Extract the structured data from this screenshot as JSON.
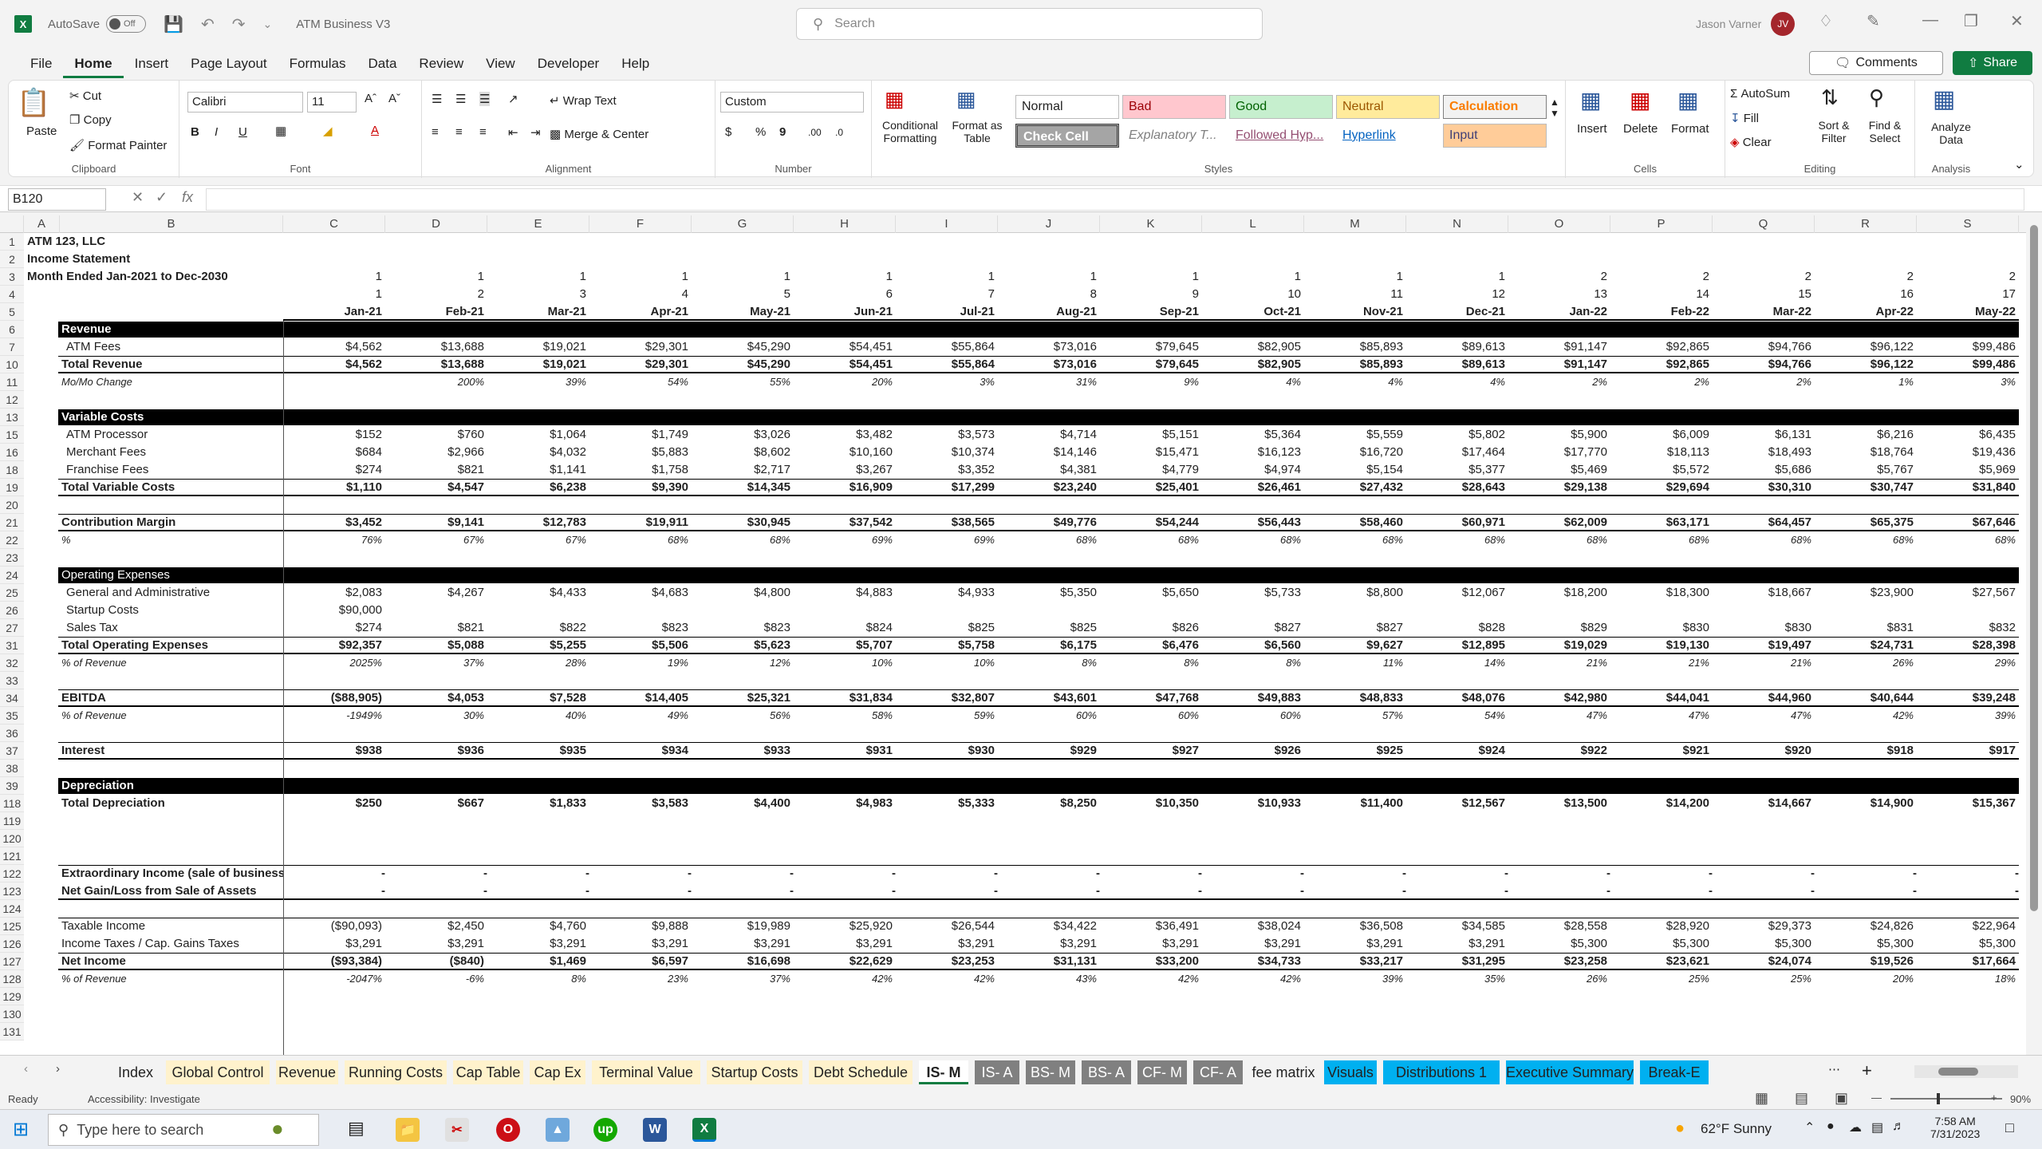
{
  "titlebar": {
    "autosave": "AutoSave",
    "autosave_state": "Off",
    "doc": "ATM Business V3",
    "search_placeholder": "Search",
    "user": "Jason Varner",
    "initials": "JV"
  },
  "menu": [
    "File",
    "Home",
    "Insert",
    "Page Layout",
    "Formulas",
    "Data",
    "Review",
    "View",
    "Developer",
    "Help"
  ],
  "buttons": {
    "comments": "Comments",
    "share": "Share"
  },
  "ribbon": {
    "paste": "Paste",
    "cut": "Cut",
    "copy": "Copy",
    "format_painter": "Format Painter",
    "clipboard": "Clipboard",
    "font_name": "Calibri",
    "font_size": "11",
    "font": "Font",
    "wrap_text": "Wrap Text",
    "merge_center": "Merge & Center",
    "alignment": "Alignment",
    "num_format": "Custom",
    "number": "Number",
    "cond_fmt": "Conditional Formatting",
    "fmt_table": "Format as Table",
    "styles": [
      "Normal",
      "Bad",
      "Good",
      "Neutral",
      "Calculation",
      "Check Cell",
      "Explanatory T...",
      "Followed Hyp...",
      "Hyperlink",
      "Input"
    ],
    "styles_label": "Styles",
    "insert": "Insert",
    "delete": "Delete",
    "format": "Format",
    "cells": "Cells",
    "autosum": "AutoSum",
    "fill": "Fill",
    "clear": "Clear",
    "sort_filter": "Sort & Filter",
    "find_select": "Find & Select",
    "editing": "Editing",
    "analyze": "Analyze Data",
    "analysis": "Analysis"
  },
  "formula": {
    "namebox": "B120",
    "fx": "fx"
  },
  "grid": {
    "columns": [
      "A",
      "B",
      "C",
      "D",
      "E",
      "F",
      "G",
      "H",
      "I",
      "J",
      "K",
      "L",
      "M",
      "N",
      "O",
      "P",
      "Q",
      "R",
      "S"
    ],
    "company": "ATM 123, LLC",
    "statement": "Income Statement",
    "period": "Month Ended Jan-2021 to Dec-2030",
    "row3": [
      "1",
      "1",
      "1",
      "1",
      "1",
      "1",
      "1",
      "1",
      "1",
      "1",
      "1",
      "1",
      "2",
      "2",
      "2",
      "2",
      "2"
    ],
    "row4": [
      "1",
      "2",
      "3",
      "4",
      "5",
      "6",
      "7",
      "8",
      "9",
      "10",
      "11",
      "12",
      "13",
      "14",
      "15",
      "16",
      "17"
    ],
    "months": [
      "Jan-21",
      "Feb-21",
      "Mar-21",
      "Apr-21",
      "May-21",
      "Jun-21",
      "Jul-21",
      "Aug-21",
      "Sep-21",
      "Oct-21",
      "Nov-21",
      "Dec-21",
      "Jan-22",
      "Feb-22",
      "Mar-22",
      "Apr-22",
      "May-22"
    ],
    "rows": [
      {
        "n": "6",
        "type": "bar",
        "label": "Revenue"
      },
      {
        "n": "7",
        "label": "ATM Fees",
        "indent": true,
        "vals": [
          "$4,562",
          "$13,688",
          "$19,021",
          "$29,301",
          "$45,290",
          "$54,451",
          "$55,864",
          "$73,016",
          "$79,645",
          "$82,905",
          "$85,893",
          "$89,613",
          "$91,147",
          "$92,865",
          "$94,766",
          "$96,122",
          "$99,486"
        ]
      },
      {
        "n": "10",
        "label": "Total Revenue",
        "bold": true,
        "topb": true,
        "botb": true,
        "vals": [
          "$4,562",
          "$13,688",
          "$19,021",
          "$29,301",
          "$45,290",
          "$54,451",
          "$55,864",
          "$73,016",
          "$79,645",
          "$82,905",
          "$85,893",
          "$89,613",
          "$91,147",
          "$92,865",
          "$94,766",
          "$96,122",
          "$99,486"
        ]
      },
      {
        "n": "11",
        "label": "Mo/Mo Change",
        "italic": true,
        "vals": [
          "",
          "200%",
          "39%",
          "54%",
          "55%",
          "20%",
          "3%",
          "31%",
          "9%",
          "4%",
          "4%",
          "4%",
          "2%",
          "2%",
          "2%",
          "1%",
          "3%"
        ]
      },
      {
        "n": "12",
        "label": ""
      },
      {
        "n": "13",
        "type": "bar",
        "label": "Variable Costs"
      },
      {
        "n": "15",
        "label": "ATM Processor",
        "indent": true,
        "vals": [
          "$152",
          "$760",
          "$1,064",
          "$1,749",
          "$3,026",
          "$3,482",
          "$3,573",
          "$4,714",
          "$5,151",
          "$5,364",
          "$5,559",
          "$5,802",
          "$5,900",
          "$6,009",
          "$6,131",
          "$6,216",
          "$6,435"
        ]
      },
      {
        "n": "16",
        "label": "Merchant Fees",
        "indent": true,
        "vals": [
          "$684",
          "$2,966",
          "$4,032",
          "$5,883",
          "$8,602",
          "$10,160",
          "$10,374",
          "$14,146",
          "$15,471",
          "$16,123",
          "$16,720",
          "$17,464",
          "$17,770",
          "$18,113",
          "$18,493",
          "$18,764",
          "$19,436"
        ]
      },
      {
        "n": "18",
        "label": "Franchise Fees",
        "indent": true,
        "vals": [
          "$274",
          "$821",
          "$1,141",
          "$1,758",
          "$2,717",
          "$3,267",
          "$3,352",
          "$4,381",
          "$4,779",
          "$4,974",
          "$5,154",
          "$5,377",
          "$5,469",
          "$5,572",
          "$5,686",
          "$5,767",
          "$5,969"
        ]
      },
      {
        "n": "19",
        "label": "Total Variable Costs",
        "bold": true,
        "topb": true,
        "botb": true,
        "vals": [
          "$1,110",
          "$4,547",
          "$6,238",
          "$9,390",
          "$14,345",
          "$16,909",
          "$17,299",
          "$23,240",
          "$25,401",
          "$26,461",
          "$27,432",
          "$28,643",
          "$29,138",
          "$29,694",
          "$30,310",
          "$30,747",
          "$31,840"
        ]
      },
      {
        "n": "20",
        "label": ""
      },
      {
        "n": "21",
        "label": "Contribution Margin",
        "bold": true,
        "topb": true,
        "botb": true,
        "vals": [
          "$3,452",
          "$9,141",
          "$12,783",
          "$19,911",
          "$30,945",
          "$37,542",
          "$38,565",
          "$49,776",
          "$54,244",
          "$56,443",
          "$58,460",
          "$60,971",
          "$62,009",
          "$63,171",
          "$64,457",
          "$65,375",
          "$67,646"
        ]
      },
      {
        "n": "22",
        "label": "%",
        "italic": true,
        "vals": [
          "76%",
          "67%",
          "67%",
          "68%",
          "68%",
          "69%",
          "69%",
          "68%",
          "68%",
          "68%",
          "68%",
          "68%",
          "68%",
          "68%",
          "68%",
          "68%",
          "68%"
        ]
      },
      {
        "n": "23",
        "label": ""
      },
      {
        "n": "24",
        "type": "bar",
        "label": "Operating Expenses",
        "normalbar": true
      },
      {
        "n": "25",
        "label": "General and Administrative",
        "indent": true,
        "vals": [
          "$2,083",
          "$4,267",
          "$4,433",
          "$4,683",
          "$4,800",
          "$4,883",
          "$4,933",
          "$5,350",
          "$5,650",
          "$5,733",
          "$8,800",
          "$12,067",
          "$18,200",
          "$18,300",
          "$18,667",
          "$23,900",
          "$27,567"
        ]
      },
      {
        "n": "26",
        "label": "Startup Costs",
        "indent": true,
        "vals": [
          "$90,000",
          "",
          "",
          "",
          "",
          "",
          "",
          "",
          "",
          "",
          "",
          "",
          "",
          "",
          "",
          "",
          ""
        ]
      },
      {
        "n": "27",
        "label": "Sales Tax",
        "indent": true,
        "vals": [
          "$274",
          "$821",
          "$822",
          "$823",
          "$823",
          "$824",
          "$825",
          "$825",
          "$826",
          "$827",
          "$827",
          "$828",
          "$829",
          "$830",
          "$830",
          "$831",
          "$832"
        ]
      },
      {
        "n": "31",
        "label": "Total Operating Expenses",
        "bold": true,
        "topb": true,
        "botb": true,
        "vals": [
          "$92,357",
          "$5,088",
          "$5,255",
          "$5,506",
          "$5,623",
          "$5,707",
          "$5,758",
          "$6,175",
          "$6,476",
          "$6,560",
          "$9,627",
          "$12,895",
          "$19,029",
          "$19,130",
          "$19,497",
          "$24,731",
          "$28,398"
        ]
      },
      {
        "n": "32",
        "label": "% of Revenue",
        "italic": true,
        "vals": [
          "2025%",
          "37%",
          "28%",
          "19%",
          "12%",
          "10%",
          "10%",
          "8%",
          "8%",
          "8%",
          "11%",
          "14%",
          "21%",
          "21%",
          "21%",
          "26%",
          "29%"
        ]
      },
      {
        "n": "33",
        "label": ""
      },
      {
        "n": "34",
        "label": "EBITDA",
        "bold": true,
        "topb": true,
        "botb": true,
        "vals": [
          "($88,905)",
          "$4,053",
          "$7,528",
          "$14,405",
          "$25,321",
          "$31,834",
          "$32,807",
          "$43,601",
          "$47,768",
          "$49,883",
          "$48,833",
          "$48,076",
          "$42,980",
          "$44,041",
          "$44,960",
          "$40,644",
          "$39,248"
        ]
      },
      {
        "n": "35",
        "label": "% of Revenue",
        "italic": true,
        "vals": [
          "-1949%",
          "30%",
          "40%",
          "49%",
          "56%",
          "58%",
          "59%",
          "60%",
          "60%",
          "60%",
          "57%",
          "54%",
          "47%",
          "47%",
          "47%",
          "42%",
          "39%"
        ]
      },
      {
        "n": "36",
        "label": ""
      },
      {
        "n": "37",
        "label": "Interest",
        "bold": true,
        "topb": true,
        "botb": true,
        "vals": [
          "$938",
          "$936",
          "$935",
          "$934",
          "$933",
          "$931",
          "$930",
          "$929",
          "$927",
          "$926",
          "$925",
          "$924",
          "$922",
          "$921",
          "$920",
          "$918",
          "$917"
        ]
      },
      {
        "n": "38",
        "label": ""
      },
      {
        "n": "39",
        "type": "bar",
        "label": "Depreciation"
      },
      {
        "n": "118",
        "label": "Total Depreciation",
        "bold": true,
        "vals": [
          "$250",
          "$667",
          "$1,833",
          "$3,583",
          "$4,400",
          "$4,983",
          "$5,333",
          "$8,250",
          "$10,350",
          "$10,933",
          "$11,400",
          "$12,567",
          "$13,500",
          "$14,200",
          "$14,667",
          "$14,900",
          "$15,367"
        ]
      },
      {
        "n": "119",
        "label": ""
      },
      {
        "n": "120",
        "label": ""
      },
      {
        "n": "121",
        "label": ""
      },
      {
        "n": "122",
        "label": "Extraordinary Income (sale of business)",
        "bold": true,
        "topb": true,
        "dash": true,
        "vals": [
          "-",
          "-",
          "-",
          "-",
          "-",
          "-",
          "-",
          "-",
          "-",
          "-",
          "-",
          "-",
          "-",
          "-",
          "-",
          "-",
          "-"
        ]
      },
      {
        "n": "123",
        "label": "Net Gain/Loss from Sale of Assets",
        "bold": true,
        "botb": true,
        "dash": true,
        "vals": [
          "-",
          "-",
          "-",
          "-",
          "-",
          "-",
          "-",
          "-",
          "-",
          "-",
          "-",
          "-",
          "-",
          "-",
          "-",
          "-",
          "-"
        ]
      },
      {
        "n": "124",
        "label": ""
      },
      {
        "n": "125",
        "label": "Taxable Income",
        "topb": true,
        "vals": [
          "($90,093)",
          "$2,450",
          "$4,760",
          "$9,888",
          "$19,989",
          "$25,920",
          "$26,544",
          "$34,422",
          "$36,491",
          "$38,024",
          "$36,508",
          "$34,585",
          "$28,558",
          "$28,920",
          "$29,373",
          "$24,826",
          "$22,964"
        ]
      },
      {
        "n": "126",
        "label": "Income Taxes / Cap. Gains Taxes",
        "vals": [
          "$3,291",
          "$3,291",
          "$3,291",
          "$3,291",
          "$3,291",
          "$3,291",
          "$3,291",
          "$3,291",
          "$3,291",
          "$3,291",
          "$3,291",
          "$3,291",
          "$5,300",
          "$5,300",
          "$5,300",
          "$5,300",
          "$5,300"
        ]
      },
      {
        "n": "127",
        "label": "Net Income",
        "bold": true,
        "topb": true,
        "botb": true,
        "vals": [
          "($93,384)",
          "($840)",
          "$1,469",
          "$6,597",
          "$16,698",
          "$22,629",
          "$23,253",
          "$31,131",
          "$33,200",
          "$34,733",
          "$33,217",
          "$31,295",
          "$23,258",
          "$23,621",
          "$24,074",
          "$19,526",
          "$17,664"
        ]
      },
      {
        "n": "128",
        "label": "% of Revenue",
        "italic": true,
        "vals": [
          "-2047%",
          "-6%",
          "8%",
          "23%",
          "37%",
          "42%",
          "42%",
          "43%",
          "42%",
          "42%",
          "39%",
          "35%",
          "26%",
          "25%",
          "25%",
          "20%",
          "18%"
        ]
      },
      {
        "n": "129",
        "label": ""
      },
      {
        "n": "130",
        "label": ""
      },
      {
        "n": "131",
        "label": ""
      }
    ]
  },
  "sheets": [
    {
      "name": "Index",
      "color": "#f3f3f3"
    },
    {
      "name": "Global Control",
      "color": "#fff2cc"
    },
    {
      "name": "Revenue",
      "color": "#fff2cc"
    },
    {
      "name": "Running Costs",
      "color": "#fff2cc"
    },
    {
      "name": "Cap Table",
      "color": "#fff2cc"
    },
    {
      "name": "Cap Ex",
      "color": "#fff2cc"
    },
    {
      "name": "Terminal Value",
      "color": "#fff2cc"
    },
    {
      "name": "Startup Costs",
      "color": "#fff2cc"
    },
    {
      "name": "Debt Schedule",
      "color": "#fff2cc"
    },
    {
      "name": "IS- M",
      "color": "#ffffff",
      "active": true
    },
    {
      "name": "IS- A",
      "color": "#808080",
      "light": true
    },
    {
      "name": "BS- M",
      "color": "#808080",
      "light": true
    },
    {
      "name": "BS- A",
      "color": "#808080",
      "light": true
    },
    {
      "name": "CF- M",
      "color": "#808080",
      "light": true
    },
    {
      "name": "CF- A",
      "color": "#808080",
      "light": true
    },
    {
      "name": "fee matrix",
      "color": "#f3f3f3"
    },
    {
      "name": "Visuals",
      "color": "#00b0f0"
    },
    {
      "name": "Distributions 1",
      "color": "#00b0f0"
    },
    {
      "name": "Executive Summary",
      "color": "#00b0f0"
    },
    {
      "name": "Break-E",
      "color": "#00b0f0"
    }
  ],
  "status": {
    "ready": "Ready",
    "accessibility": "Accessibility: Investigate",
    "zoom": "90%"
  },
  "taskbar": {
    "search": "Type here to search",
    "weather": "62°F  Sunny",
    "time": "7:58 AM",
    "date": "7/31/2023"
  }
}
